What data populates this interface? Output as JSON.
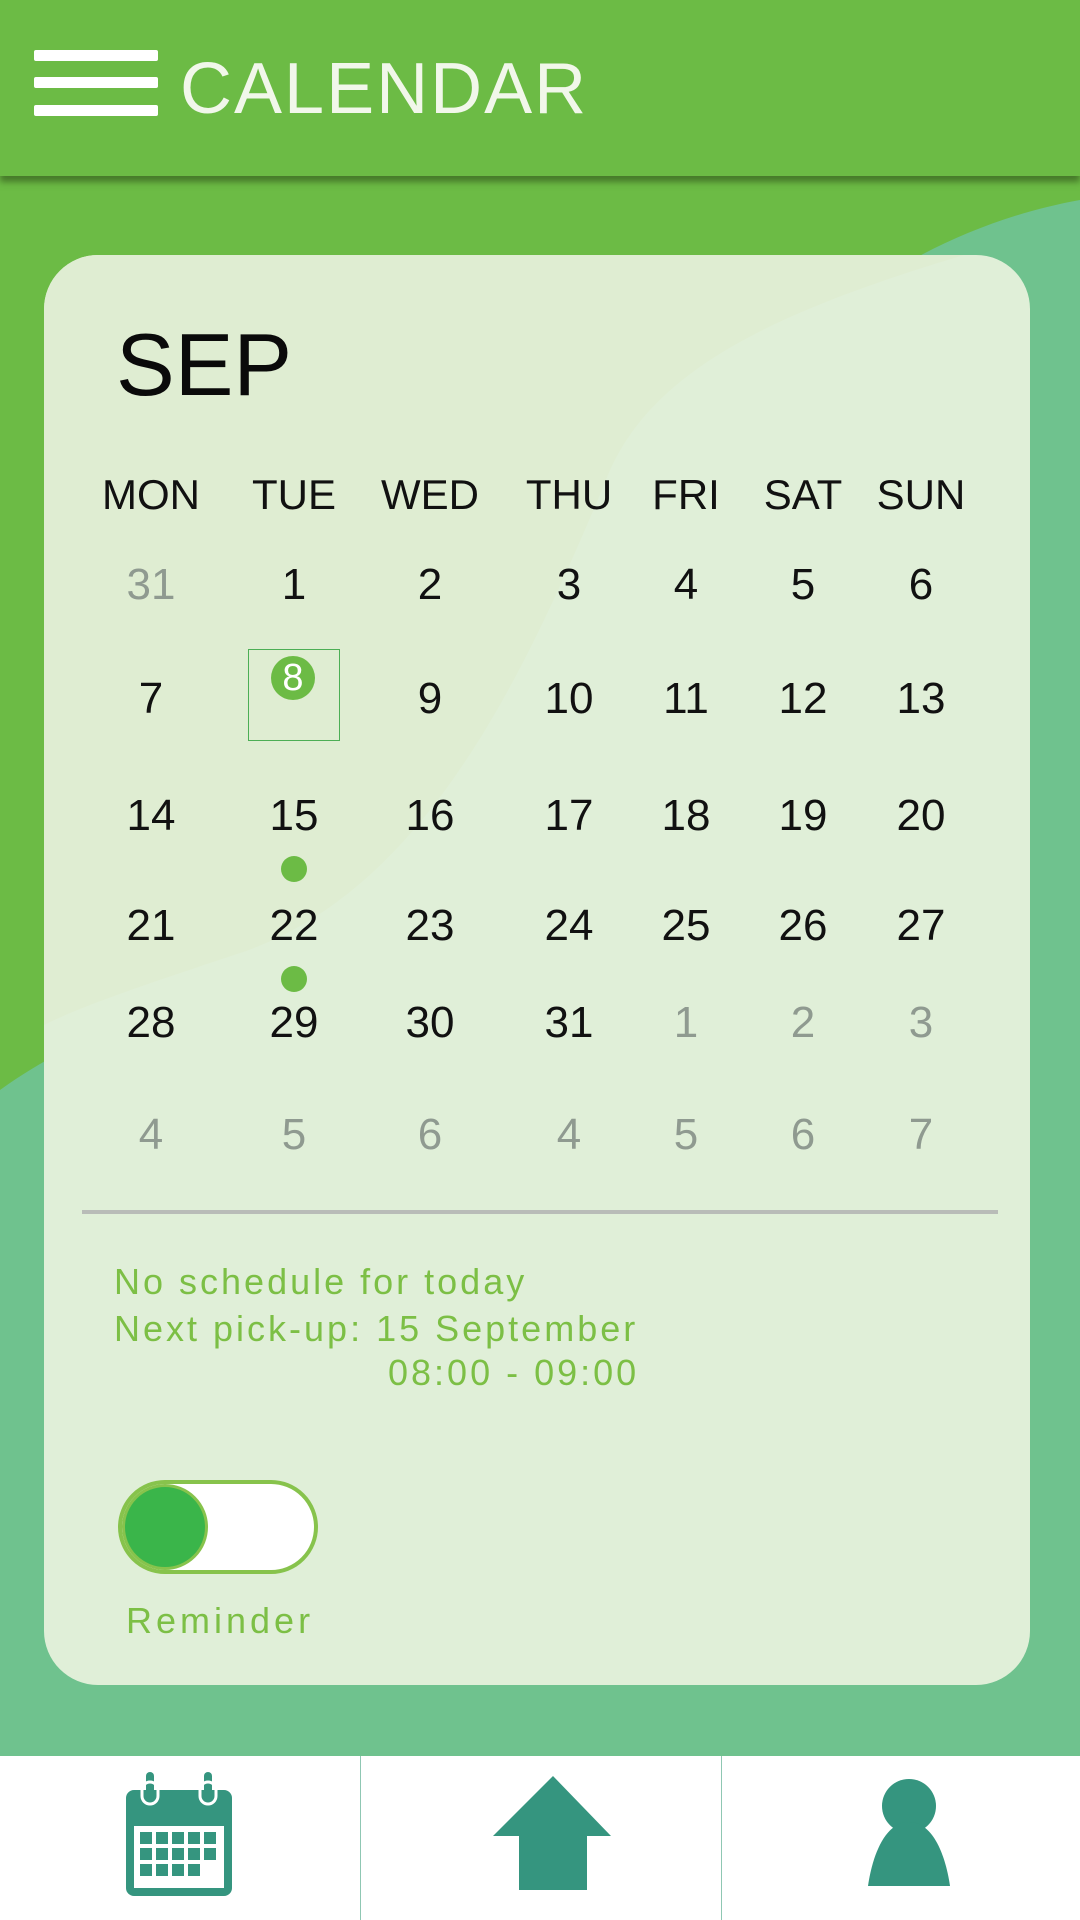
{
  "header": {
    "title": "CALENDAR",
    "menu_icon": "hamburger-menu-icon"
  },
  "calendar": {
    "month": "SEP",
    "weekdays": [
      "MON",
      "TUE",
      "WED",
      "THU",
      "FRI",
      "SAT",
      "SUN"
    ],
    "weeks": [
      [
        "31",
        "1",
        "2",
        "3",
        "4",
        "5",
        "6"
      ],
      [
        "7",
        "8",
        "9",
        "10",
        "11",
        "12",
        "13"
      ],
      [
        "14",
        "15",
        "16",
        "17",
        "18",
        "19",
        "20"
      ],
      [
        "21",
        "22",
        "23",
        "24",
        "25",
        "26",
        "27"
      ],
      [
        "28",
        "29",
        "30",
        "31",
        "1",
        "2",
        "3"
      ],
      [
        "4",
        "5",
        "6",
        "4",
        "5",
        "6",
        "7"
      ]
    ],
    "today": "8",
    "event_days": [
      "15",
      "22"
    ]
  },
  "schedule": {
    "today_status": "No schedule for today",
    "next_pickup": "Next pick-up: 15 September",
    "pickup_time": "08:00 - 09:00"
  },
  "reminder": {
    "label": "Reminder",
    "enabled": true
  },
  "bottom_nav": {
    "items": [
      {
        "icon": "calendar-icon"
      },
      {
        "icon": "home-icon"
      },
      {
        "icon": "profile-icon"
      }
    ]
  },
  "colors": {
    "header_green": "#6cbb45",
    "background_teal": "#6fc28e",
    "card_bg": "#e0efd8",
    "accent_green": "#7cbf45",
    "nav_icon": "#35957f",
    "toggle_knob": "#3ab54a"
  }
}
